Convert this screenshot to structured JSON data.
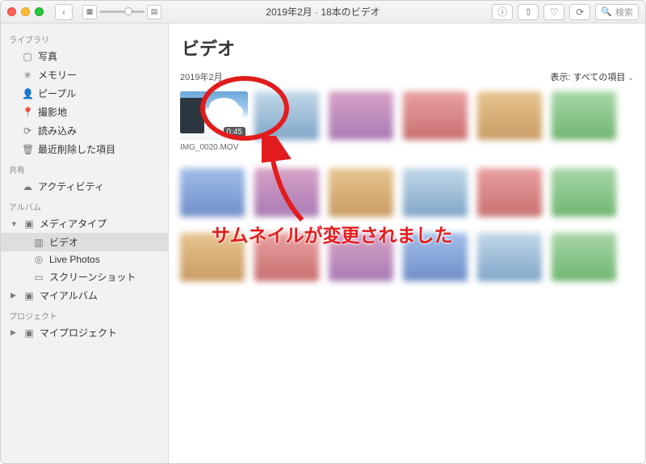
{
  "window_title": "2019年2月 · 18本のビデオ",
  "search_placeholder": "検索",
  "sidebar": {
    "sections": {
      "library": "ライブラリ",
      "shared": "共有",
      "albums": "アルバム",
      "projects": "プロジェクト"
    },
    "library_items": [
      "写真",
      "メモリー",
      "ピープル",
      "撮影地",
      "読み込み",
      "最近削除した項目"
    ],
    "shared_items": [
      "アクティビティ"
    ],
    "albums_root": "メディアタイプ",
    "albums_children": [
      "ビデオ",
      "Live Photos",
      "スクリーンショット"
    ],
    "my_albums": "マイアルバム",
    "projects_root": "マイプロジェクト",
    "selected": "ビデオ"
  },
  "main": {
    "heading": "ビデオ",
    "group_label": "2019年2月",
    "display_label": "表示:",
    "display_value": "すべての項目",
    "featured": {
      "filename": "IMG_0020.MOV",
      "duration": "0:45"
    }
  },
  "annotation": {
    "text": "サムネイルが変更されました"
  },
  "icons": {
    "back": "‹",
    "grid_small": "▦",
    "grid_large": "▤",
    "info": "ⓘ",
    "share": "⇧",
    "favorite": "♡",
    "rotate": "⟳",
    "search": "🔍",
    "photo": "▢",
    "memory": "✳",
    "people": "👤",
    "places": "📍",
    "import": "⟳",
    "trash": "🗑",
    "cloud": "☁",
    "folder": "▸",
    "video": "▥",
    "live": "◎",
    "screenshot": "▭",
    "chevron": "⌄"
  }
}
